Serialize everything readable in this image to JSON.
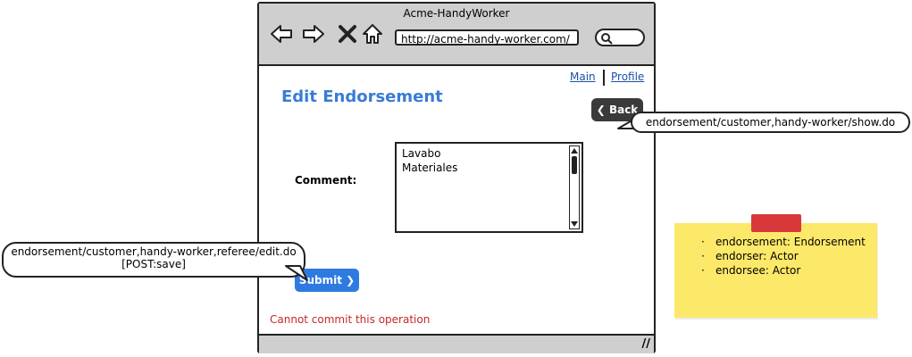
{
  "window": {
    "title": "Acme-HandyWorker"
  },
  "browser": {
    "url": "http://acme-handy-worker.com/"
  },
  "header_links": {
    "main": "Main",
    "profile": "Profile"
  },
  "page": {
    "title": "Edit Endorsement",
    "back_label": "Back",
    "comment_label": "Comment:",
    "comment_lines": [
      "Lavabo",
      "Materiales"
    ],
    "submit_label": "Submit",
    "error": "Cannot commit this operation"
  },
  "callouts": {
    "back": "endorsement/customer,handy-worker/show.do",
    "submit_line1": "endorsement/customer,handy-worker,referee/edit.do",
    "submit_line2": "[POST:save]"
  },
  "note": {
    "items": [
      "endorsement: Endorsement",
      "endorser: Actor",
      "endorsee: Actor"
    ]
  },
  "colors": {
    "title_blue": "#3a7bd5",
    "submit_blue": "#2d7be0",
    "error_red": "#c62828",
    "note_yellow": "#fce96a",
    "tape_red": "#d9383a"
  }
}
